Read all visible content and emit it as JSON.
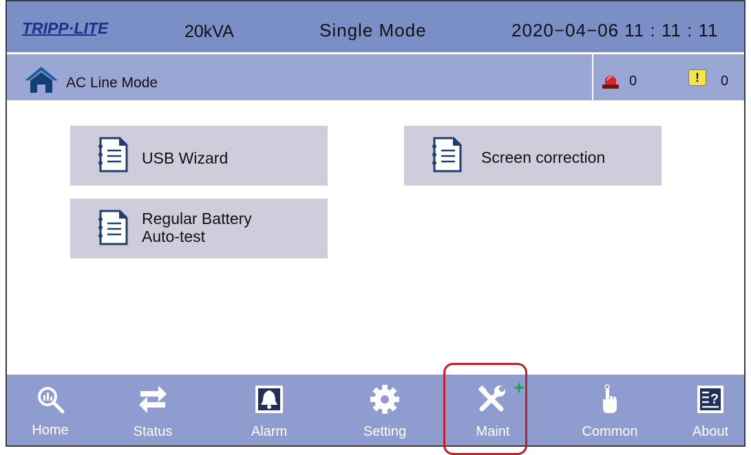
{
  "header": {
    "logo_text": "TRIPP·LITE",
    "rating": "20kVA",
    "mode": "Single Mode",
    "datetime": "2020−04−06 11 : 11 : 11"
  },
  "status": {
    "home_icon": "home-icon",
    "text": "AC Line Mode",
    "alarm_count": "0",
    "warning_symbol": "!",
    "warning_count": "0"
  },
  "menu": {
    "usb_wizard": "USB Wizard",
    "screen_correction": "Screen correction",
    "battery_test_line1": "Regular Battery",
    "battery_test_line2": "Auto-test"
  },
  "nav": {
    "home": "Home",
    "status": "Status",
    "alarm": "Alarm",
    "setting": "Setting",
    "maint": "Maint",
    "common": "Common",
    "about": "About",
    "active": "Maint"
  },
  "colors": {
    "topbar": "#7b8fc7",
    "statusbar": "#9aa6d4",
    "navbar": "#8e9ccf",
    "button": "#cfcddc",
    "highlight": "#c0202a"
  }
}
